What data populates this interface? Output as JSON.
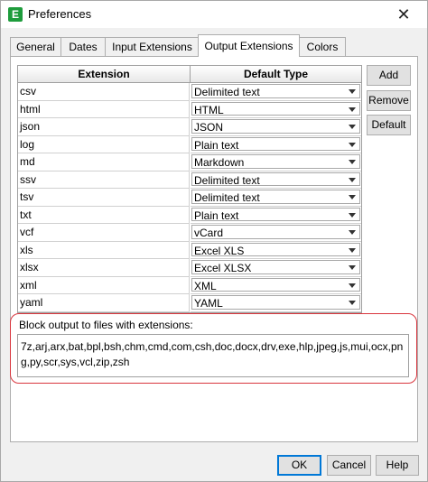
{
  "window": {
    "title": "Preferences",
    "close_glyph": "close-icon"
  },
  "tabs": [
    {
      "label": "General"
    },
    {
      "label": "Dates"
    },
    {
      "label": "Input Extensions"
    },
    {
      "label": "Output Extensions",
      "selected": true
    },
    {
      "label": "Colors"
    }
  ],
  "table": {
    "headers": {
      "extension": "Extension",
      "type": "Default Type"
    },
    "rows": [
      {
        "ext": "csv",
        "type": "Delimited text"
      },
      {
        "ext": "html",
        "type": "HTML"
      },
      {
        "ext": "json",
        "type": "JSON"
      },
      {
        "ext": "log",
        "type": "Plain text"
      },
      {
        "ext": "md",
        "type": "Markdown"
      },
      {
        "ext": "ssv",
        "type": "Delimited text"
      },
      {
        "ext": "tsv",
        "type": "Delimited text"
      },
      {
        "ext": "txt",
        "type": "Plain text"
      },
      {
        "ext": "vcf",
        "type": "vCard"
      },
      {
        "ext": "xls",
        "type": "Excel XLS"
      },
      {
        "ext": "xlsx",
        "type": "Excel XLSX"
      },
      {
        "ext": "xml",
        "type": "XML"
      },
      {
        "ext": "yaml",
        "type": "YAML"
      }
    ]
  },
  "side_buttons": {
    "add": "Add",
    "remove": "Remove",
    "default": "Default"
  },
  "block": {
    "label": "Block output to files with extensions:",
    "value": "7z,arj,arx,bat,bpl,bsh,chm,cmd,com,csh,doc,docx,drv,exe,hlp,jpeg,js,mui,ocx,png,py,scr,sys,vcl,zip,zsh"
  },
  "footer": {
    "ok": "OK",
    "cancel": "Cancel",
    "help": "Help"
  },
  "colors": {
    "accent": "#0078d7",
    "highlight": "#d9363e",
    "app_icon": "#1e9c3c"
  }
}
